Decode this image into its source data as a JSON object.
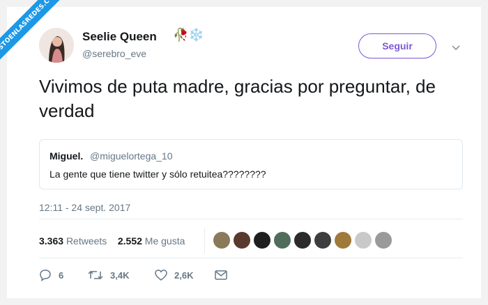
{
  "watermark": "VISTOENLASREDES.COM",
  "user": {
    "name": "Seelie Queen",
    "name_emoji": "🥀❄️",
    "handle": "@serebro_eve"
  },
  "follow_label": "Seguir",
  "tweet_text": "Vivimos de puta madre, gracias por preguntar, de verdad",
  "quote": {
    "name": "Miguel.",
    "handle": "@miguelortega_10",
    "text": "La gente que tiene twitter y sólo retuitea????????"
  },
  "timestamp": "12:11 - 24 sept. 2017",
  "stats": {
    "retweets_count": "3.363",
    "retweets_label": "Retweets",
    "likes_count": "2.552",
    "likes_label": "Me gusta"
  },
  "actions": {
    "replies": "6",
    "retweets": "3,4K",
    "likes": "2,6K"
  },
  "icons": [
    "chevron-down-icon",
    "reply-icon",
    "retweet-icon",
    "like-icon",
    "message-icon"
  ],
  "colors": {
    "follow_accent": "#7c57d6",
    "watermark_bg": "#1d98e6",
    "muted_text": "#657786"
  }
}
